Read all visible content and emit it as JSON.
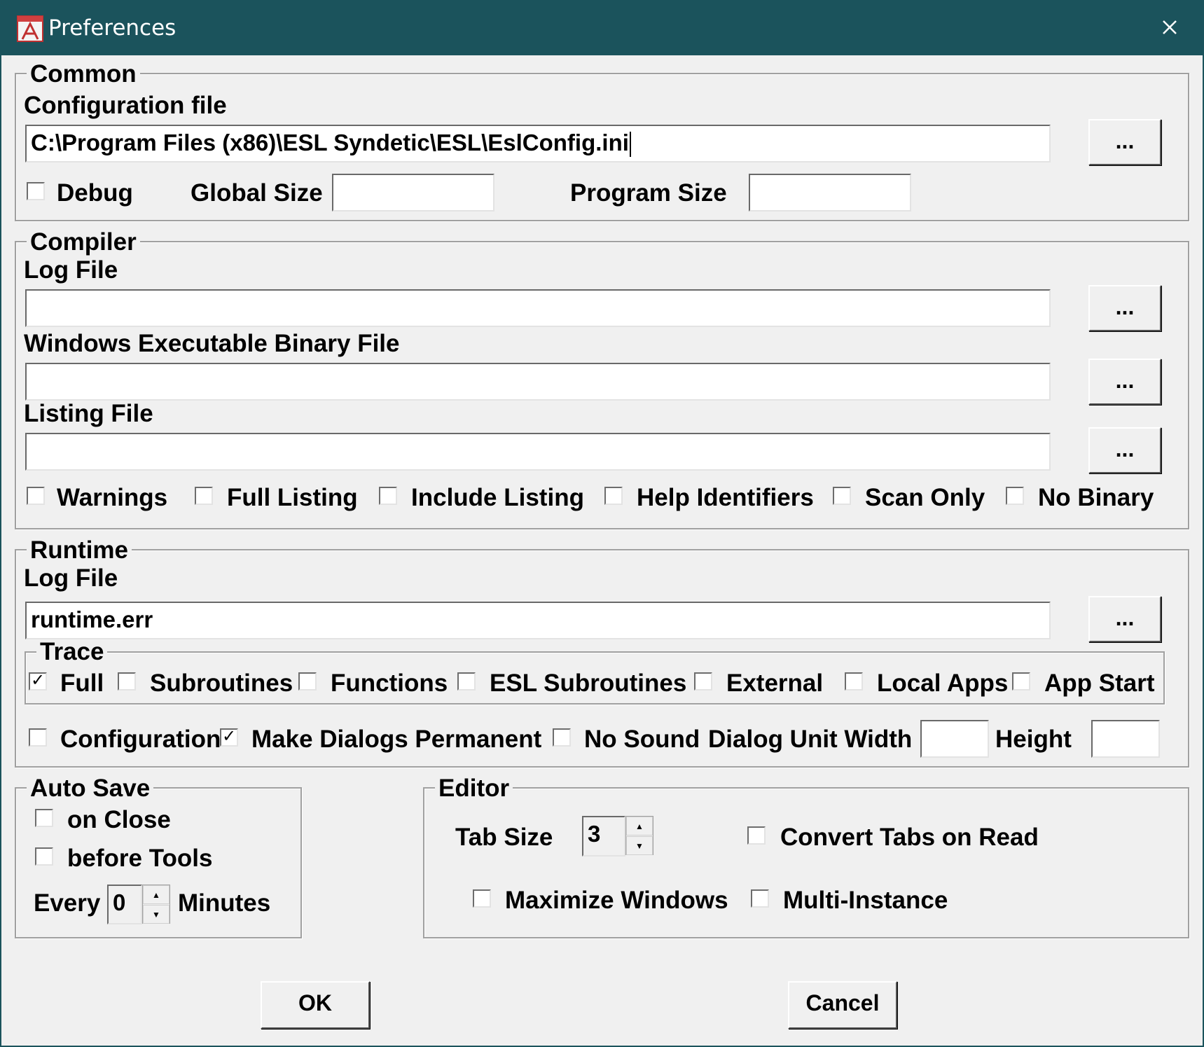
{
  "window": {
    "title": "Preferences"
  },
  "common": {
    "legend": "Common",
    "config_label": "Configuration file",
    "config_value": "C:\\Program Files (x86)\\ESL Syndetic\\ESL\\EslConfig.ini",
    "browse_label": "...",
    "debug_label": "Debug",
    "debug_checked": false,
    "global_size_label": "Global Size",
    "global_size_value": "",
    "program_size_label": "Program Size",
    "program_size_value": ""
  },
  "compiler": {
    "legend": "Compiler",
    "log_label": "Log File",
    "log_value": "",
    "exe_label": "Windows Executable Binary File",
    "exe_value": "",
    "listing_label": "Listing File",
    "listing_value": "",
    "browse_label": "...",
    "options": [
      {
        "label": "Warnings",
        "checked": false
      },
      {
        "label": "Full Listing",
        "checked": false
      },
      {
        "label": "Include Listing",
        "checked": false
      },
      {
        "label": "Help Identifiers",
        "checked": false
      },
      {
        "label": "Scan Only",
        "checked": false
      },
      {
        "label": "No Binary",
        "checked": false
      }
    ]
  },
  "runtime": {
    "legend": "Runtime",
    "log_label": "Log File",
    "log_value": "runtime.err",
    "browse_label": "...",
    "trace": {
      "legend": "Trace",
      "options": [
        {
          "label": "Full",
          "checked": true
        },
        {
          "label": "Subroutines",
          "checked": false
        },
        {
          "label": "Functions",
          "checked": false
        },
        {
          "label": "ESL Subroutines",
          "checked": false
        },
        {
          "label": "External",
          "checked": false
        },
        {
          "label": "Local Apps",
          "checked": false
        },
        {
          "label": "App Start",
          "checked": false
        }
      ]
    },
    "configuration_label": "Configuration",
    "configuration_checked": false,
    "permanent_label": "Make Dialogs Permanent",
    "permanent_checked": true,
    "nosound_label": "No Sound",
    "nosound_checked": false,
    "unit_width_label": "Dialog Unit Width",
    "unit_width_value": "",
    "height_label": "Height",
    "height_value": ""
  },
  "autosave": {
    "legend": "Auto Save",
    "on_close_label": "on Close",
    "on_close_checked": false,
    "before_tools_label": "before Tools",
    "before_tools_checked": false,
    "every_label": "Every",
    "every_value": "0",
    "minutes_label": "Minutes"
  },
  "editor": {
    "legend": "Editor",
    "tab_size_label": "Tab Size",
    "tab_size_value": "3",
    "convert_tabs_label": "Convert Tabs on Read",
    "convert_tabs_checked": false,
    "maximize_label": "Maximize Windows",
    "maximize_checked": false,
    "multi_label": "Multi-Instance",
    "multi_checked": false
  },
  "buttons": {
    "ok": "OK",
    "cancel": "Cancel"
  }
}
